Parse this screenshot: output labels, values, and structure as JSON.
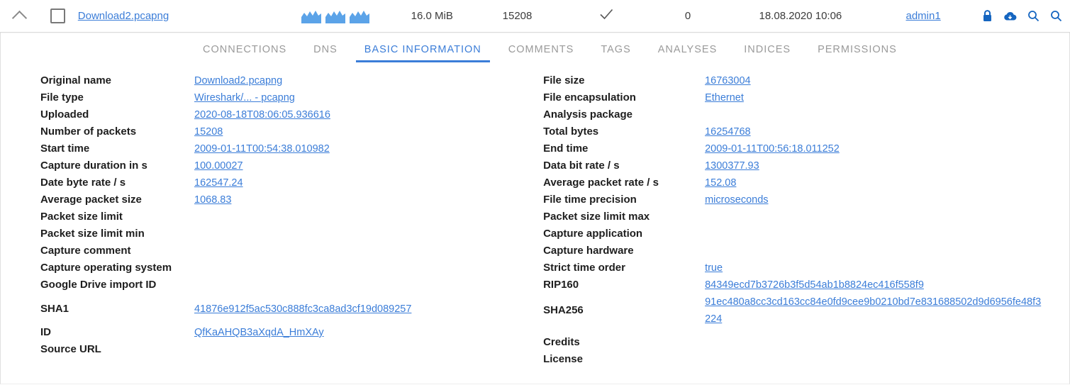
{
  "toprow": {
    "collapse_icon": "chevron-up-icon",
    "select_checkbox": "checkbox-unchecked",
    "file_name": "Download2.pcapng",
    "traffic_icon": "traffic-sparkline-icon",
    "file_size": "16.0 MiB",
    "packet_count": "15208",
    "status_icon": "check-icon",
    "zero_value": "0",
    "uploaded_at": "18.08.2020 10:06",
    "user": "admin1",
    "icons": [
      "lock-icon",
      "cloud-download-icon",
      "search-icon",
      "search-icon"
    ]
  },
  "tabs": [
    {
      "label": "CONNECTIONS",
      "active": false
    },
    {
      "label": "DNS",
      "active": false
    },
    {
      "label": "BASIC INFORMATION",
      "active": true
    },
    {
      "label": "COMMENTS",
      "active": false
    },
    {
      "label": "TAGS",
      "active": false
    },
    {
      "label": "ANALYSES",
      "active": false
    },
    {
      "label": "INDICES",
      "active": false
    },
    {
      "label": "PERMISSIONS",
      "active": false
    }
  ],
  "left_column": [
    {
      "label": "Original name",
      "value": "Download2.pcapng",
      "link": true
    },
    {
      "label": "File type",
      "value": "Wireshark/... - pcapng",
      "link": true
    },
    {
      "label": "Uploaded",
      "value": "2020-08-18T08:06:05.936616",
      "link": true
    },
    {
      "label": "Number of packets",
      "value": "15208",
      "link": true
    },
    {
      "label": "Start time",
      "value": "2009-01-11T00:54:38.010982",
      "link": true
    },
    {
      "label": "Capture duration in s",
      "value": "100.00027",
      "link": true
    },
    {
      "label": "Date byte rate / s",
      "value": "162547.24",
      "link": true
    },
    {
      "label": "Average packet size",
      "value": "1068.83",
      "link": true
    },
    {
      "label": "Packet size limit",
      "value": "",
      "link": false
    },
    {
      "label": "Packet size limit min",
      "value": "",
      "link": false
    },
    {
      "label": "Capture comment",
      "value": "",
      "link": false
    },
    {
      "label": "Capture operating system",
      "value": "",
      "link": false
    },
    {
      "label": "Google Drive import ID",
      "value": "",
      "link": false
    },
    {
      "label": "SHA1",
      "value": "41876e912f5ac530c888fc3ca8ad3cf19d089257",
      "link": true
    },
    {
      "label": "ID",
      "value": "QfKaAHQB3aXqdA_HmXAy",
      "link": true
    },
    {
      "label": "Source URL",
      "value": "",
      "link": false
    }
  ],
  "right_column": [
    {
      "label": "File size",
      "value": "16763004",
      "link": true
    },
    {
      "label": "File encapsulation",
      "value": "Ethernet",
      "link": true
    },
    {
      "label": "Analysis package",
      "value": "",
      "link": false
    },
    {
      "label": "Total bytes",
      "value": "16254768",
      "link": true
    },
    {
      "label": "End time",
      "value": "2009-01-11T00:56:18.011252",
      "link": true
    },
    {
      "label": "Data bit rate / s",
      "value": "1300377.93",
      "link": true
    },
    {
      "label": "Average packet rate / s",
      "value": "152.08",
      "link": true
    },
    {
      "label": "File time precision",
      "value": "microseconds",
      "link": true
    },
    {
      "label": "Packet size limit max",
      "value": "",
      "link": false
    },
    {
      "label": "Capture application",
      "value": "",
      "link": false
    },
    {
      "label": "Capture hardware",
      "value": "",
      "link": false
    },
    {
      "label": "Strict time order",
      "value": "true",
      "link": true
    },
    {
      "label": "RIP160",
      "value": "84349ecd7b3726b3f5d54ab1b8824ec416f558f9",
      "link": true
    },
    {
      "label": "SHA256",
      "value": "91ec480a8cc3cd163cc84e0fd9cee9b0210bd7e831688502d9d6956fe48f3224",
      "link": true
    },
    {
      "label": "Credits",
      "value": "",
      "link": false
    },
    {
      "label": "License",
      "value": "",
      "link": false
    }
  ],
  "colors": {
    "link": "#3b7dd8",
    "accent": "#3b7dd8",
    "tab_inactive": "#9a9a9a",
    "label": "#1e1e1e",
    "sparkline": "#5ba3e8",
    "icon_blue": "#1565c0"
  }
}
